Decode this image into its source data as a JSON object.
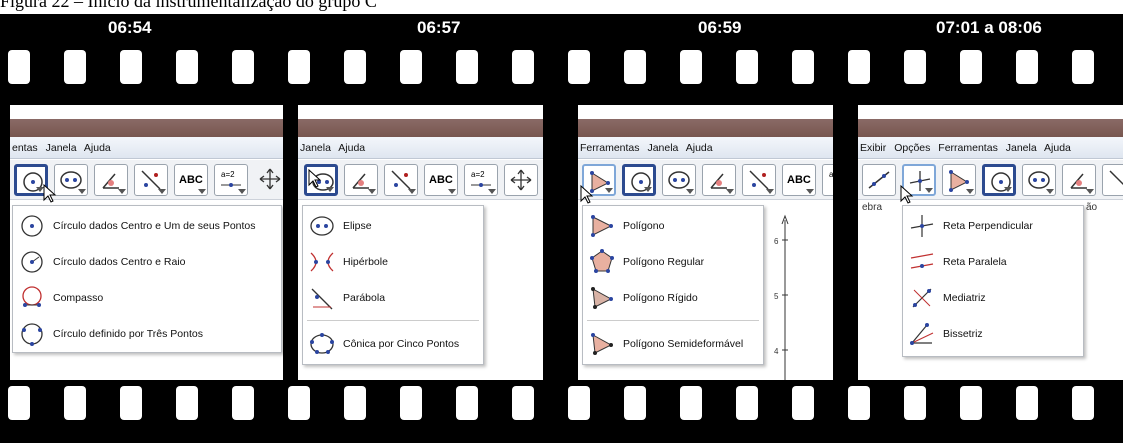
{
  "caption": "Figura 22 – Início da instrumentalização do grupo C",
  "frames": [
    {
      "time": "06:54",
      "menubar": [
        "entas",
        "Janela",
        "Ajuda"
      ],
      "menu_items": [
        "Círculo dados Centro e Um de seus Pontos",
        "Círculo dados Centro e Raio",
        "Compasso",
        "Círculo definido por Três Pontos"
      ],
      "abc": "ABC",
      "a2": "a=2"
    },
    {
      "time": "06:57",
      "menubar": [
        "Janela",
        "Ajuda"
      ],
      "menu_items": [
        "Elipse",
        "Hipérbole",
        "Parábola",
        "Cônica por Cinco Pontos"
      ],
      "abc": "ABC",
      "a2": "a=2"
    },
    {
      "time": "06:59",
      "menubar": [
        "Ferramentas",
        "Janela",
        "Ajuda"
      ],
      "menu_items": [
        "Polígono",
        "Polígono Regular",
        "Polígono Rígido",
        "Polígono Semideformável"
      ],
      "abc": "ABC",
      "a2": "a=",
      "axis_labels": [
        "6",
        "5",
        "4"
      ]
    },
    {
      "time": "07:01 a 08:06",
      "menubar": [
        "Exibir",
        "Opções",
        "Ferramentas",
        "Janela",
        "Ajuda"
      ],
      "menu_items": [
        "Reta Perpendicular",
        "Reta Paralela",
        "Mediatriz",
        "Bissetriz"
      ],
      "left_fragment": "ebra",
      "right_fragment": "ão"
    }
  ]
}
